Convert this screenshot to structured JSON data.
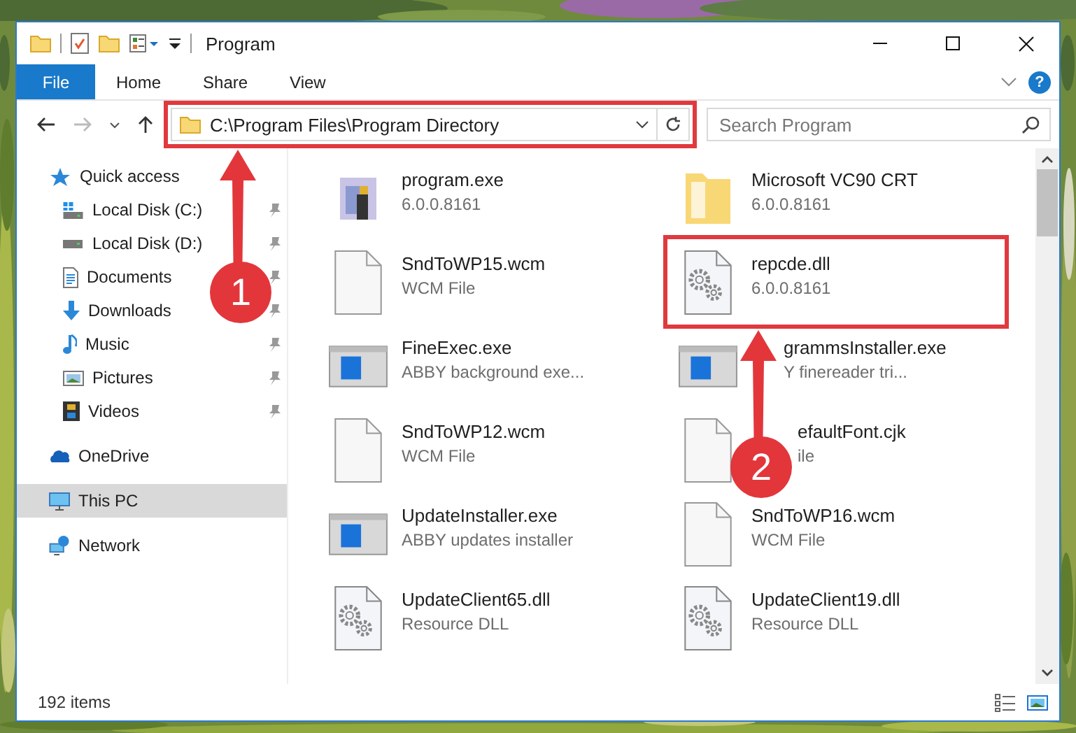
{
  "window": {
    "title": "Program"
  },
  "ribbon_tabs": [
    {
      "label": "File",
      "kind": "file"
    },
    {
      "label": "Home",
      "kind": "tab"
    },
    {
      "label": "Share",
      "kind": "tab"
    },
    {
      "label": "View",
      "kind": "tab"
    }
  ],
  "help_button": {
    "label": "?"
  },
  "address_bar": {
    "path": "C:\\Program Files\\Program Directory",
    "callout": "1"
  },
  "search": {
    "placeholder": "Search Program"
  },
  "sidebar": {
    "items": [
      {
        "label": "Quick access",
        "kind": "star",
        "selected": false,
        "children": [
          {
            "label": "Local Disk (C:)",
            "kind": "system-drive",
            "pinned": true,
            "selected": false
          },
          {
            "label": "Local Disk (D:)",
            "kind": "drive",
            "pinned": true,
            "selected": false
          },
          {
            "label": "Documents",
            "kind": "document",
            "pinned": true,
            "selected": false
          },
          {
            "label": "Downloads",
            "kind": "download",
            "pinned": true,
            "selected": false
          },
          {
            "label": "Music",
            "kind": "music",
            "pinned": true,
            "selected": false
          },
          {
            "label": "Pictures",
            "kind": "picture",
            "pinned": true,
            "selected": false
          },
          {
            "label": "Videos",
            "kind": "film",
            "pinned": true,
            "selected": false
          }
        ]
      },
      {
        "label": "OneDrive",
        "kind": "cloud",
        "selected": false
      },
      {
        "label": "This PC",
        "kind": "monitor",
        "selected": true
      },
      {
        "label": "Network",
        "kind": "network",
        "selected": false
      }
    ]
  },
  "file_rows": [
    {
      "files": [
        {
          "name": "program.exe",
          "detail": "6.0.0.8161",
          "kind": "installer"
        },
        {
          "name": "Microsoft VC90 CRT",
          "detail": "6.0.0.8161",
          "kind": "folder"
        }
      ]
    },
    {
      "files": [
        {
          "name": "SndToWP15.wcm",
          "detail": "WCM File",
          "kind": "blank"
        },
        {
          "name": "repcde.dll",
          "detail": "6.0.0.8161",
          "kind": "gear",
          "callout": "2"
        }
      ]
    },
    {
      "files": [
        {
          "name": "FineExec.exe",
          "detail": "ABBY background exe...",
          "kind": "window"
        },
        {
          "name": "grammsInstaller.exe",
          "detail": "Y finereader tri...",
          "kind": "window"
        }
      ]
    },
    {
      "files": [
        {
          "name": "SndToWP12.wcm",
          "detail": "WCM File",
          "kind": "blank"
        },
        {
          "name": "efaultFont.cjk",
          "detail": "ile",
          "kind": "blank"
        }
      ]
    },
    {
      "files": [
        {
          "name": "UpdateInstaller.exe",
          "detail": "ABBY updates installer",
          "kind": "window"
        },
        {
          "name": "SndToWP16.wcm",
          "detail": "WCM File",
          "kind": "blank"
        }
      ]
    },
    {
      "files": [
        {
          "name": "UpdateClient65.dll",
          "detail": "Resource DLL",
          "kind": "gear"
        },
        {
          "name": "UpdateClient19.dll",
          "detail": "Resource DLL",
          "kind": "gear"
        }
      ]
    }
  ],
  "status_bar": {
    "item_count": "192 items"
  }
}
